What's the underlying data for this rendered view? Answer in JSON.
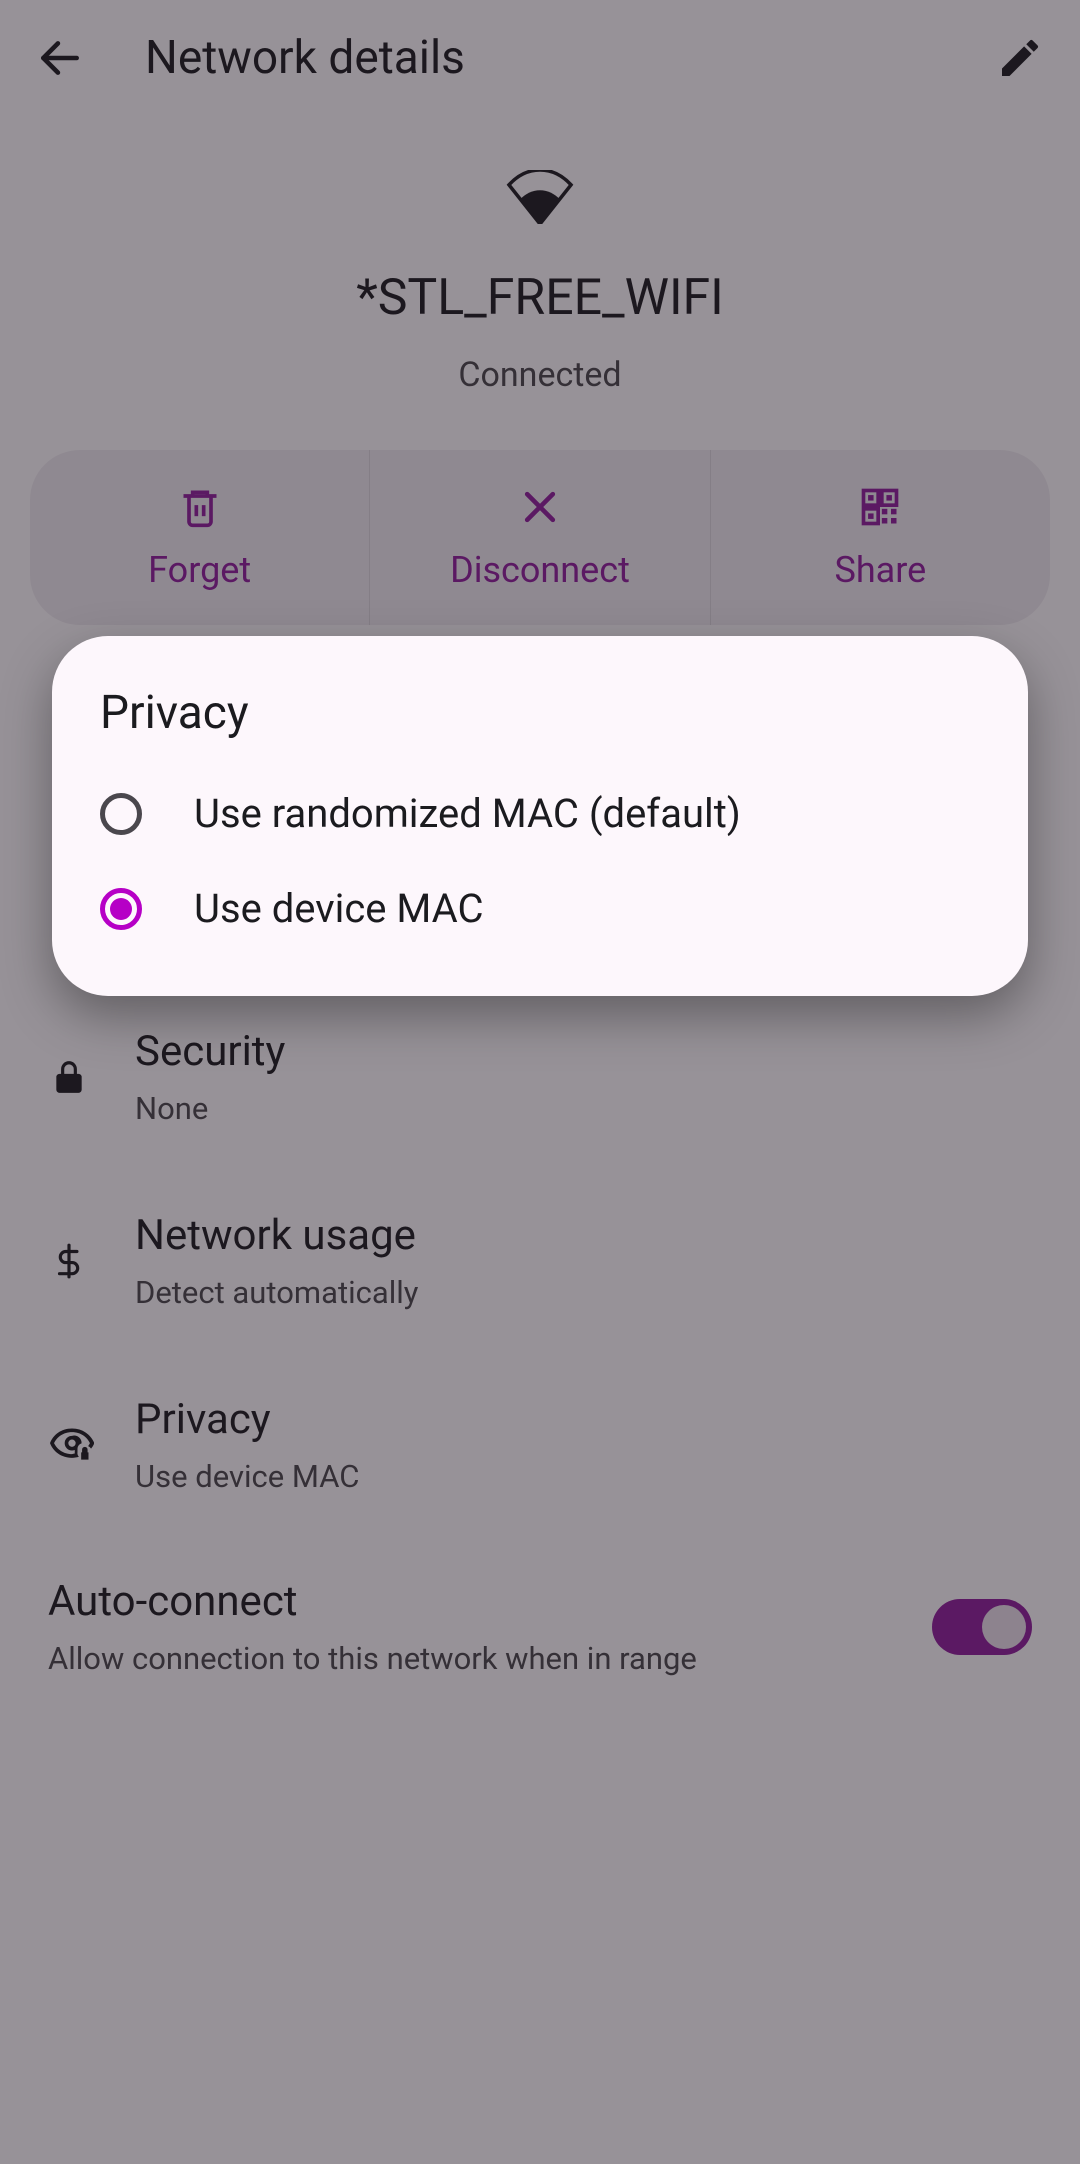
{
  "header": {
    "title": "Network details"
  },
  "network": {
    "ssid": "*STL_FREE_WIFI",
    "status": "Connected"
  },
  "actions": {
    "forget": "Forget",
    "disconnect": "Disconnect",
    "share": "Share"
  },
  "rows": {
    "security": {
      "title": "Security",
      "value": "None"
    },
    "usage": {
      "title": "Network usage",
      "value": "Detect automatically"
    },
    "privacy": {
      "title": "Privacy",
      "value": "Use device MAC"
    }
  },
  "autoconnect": {
    "title": "Auto-connect",
    "subtitle": "Allow connection to this network when in range",
    "enabled": true
  },
  "dialog": {
    "title": "Privacy",
    "options": [
      {
        "label": "Use randomized MAC (default)",
        "selected": false
      },
      {
        "label": "Use device MAC",
        "selected": true
      }
    ]
  },
  "colors": {
    "accent": "#8c1d9b"
  }
}
